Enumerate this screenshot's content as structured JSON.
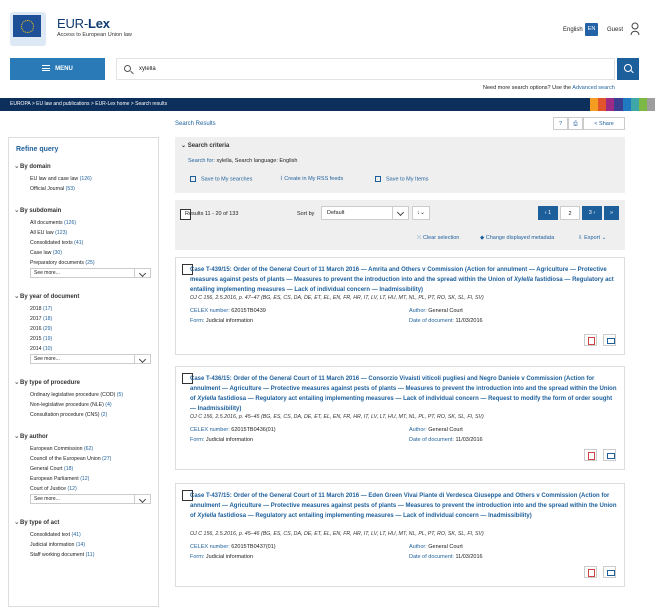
{
  "header": {
    "site_name_prefix": "EUR-",
    "site_name_bold": "Lex",
    "tagline": "Access to European Union law",
    "language": "English",
    "language_code": "EN",
    "user": "Guest"
  },
  "search": {
    "menu_label": "MENU",
    "query": "xylella",
    "advanced_prompt": "Need more search options? Use the",
    "advanced_link": "Advanced search"
  },
  "breadcrumb": "EUROPA  >  EU law and publications  >  EUR-Lex home  >  Search results",
  "colors": {
    "accent": "#1d5f9b",
    "menu": "#2a7ab8",
    "breadcrumb_bg": "#0d2f5b",
    "stripes": [
      "#f59d22",
      "#e2542b",
      "#9c2b86",
      "#3a3f91",
      "#1f7ac1",
      "#3fa7a7",
      "#7bb844",
      "#9e9e9e"
    ]
  },
  "sidebar": {
    "title": "Refine query",
    "groups": [
      {
        "heading": "By domain",
        "items": [
          {
            "label": "EU law and case law",
            "count": "(126)"
          },
          {
            "label": "Official Journal",
            "count": "(53)"
          }
        ],
        "see_more": ""
      },
      {
        "heading": "By subdomain",
        "items": [
          {
            "label": "All documents",
            "count": "(126)"
          },
          {
            "label": "All EU law",
            "count": "(123)"
          },
          {
            "label": "Consolidated texts",
            "count": "(41)"
          },
          {
            "label": "Case law",
            "count": "(30)"
          },
          {
            "label": "Preparatory documents",
            "count": "(25)"
          }
        ],
        "see_more": "See more..."
      },
      {
        "heading": "By year of document",
        "items": [
          {
            "label": "2018",
            "count": "(17)"
          },
          {
            "label": "2017",
            "count": "(18)"
          },
          {
            "label": "2016",
            "count": "(29)"
          },
          {
            "label": "2015",
            "count": "(19)"
          },
          {
            "label": "2014",
            "count": "(10)"
          }
        ],
        "see_more": "See more..."
      },
      {
        "heading": "By type of procedure",
        "items": [
          {
            "label": "Ordinary legislative procedure (COD)",
            "count": "(5)"
          },
          {
            "label": "Non-legislative procedure (NLE)",
            "count": "(4)"
          },
          {
            "label": "Consultation procedure (CNS)",
            "count": "(2)"
          }
        ],
        "see_more": ""
      },
      {
        "heading": "By author",
        "items": [
          {
            "label": "European Commission",
            "count": "(62)"
          },
          {
            "label": "Council of the European Union",
            "count": "(27)"
          },
          {
            "label": "General Court",
            "count": "(18)"
          },
          {
            "label": "European Parliament",
            "count": "(12)"
          },
          {
            "label": "Court of Justice",
            "count": "(12)"
          }
        ],
        "see_more": "See more..."
      },
      {
        "heading": "By type of act",
        "items": [
          {
            "label": "Consolidated text",
            "count": "(41)"
          },
          {
            "label": "Judicial information",
            "count": "(14)"
          },
          {
            "label": "Staff working document",
            "count": "(11)"
          }
        ],
        "see_more": ""
      }
    ]
  },
  "main": {
    "title": "Search Results",
    "help": "?",
    "print": "⎙",
    "share": "Share",
    "criteria_heading": "Search criteria",
    "criteria_label": "Search for:",
    "criteria_value": "xylella, Search language: English",
    "save_searches": "Save to My searches",
    "create_rss": "Create in My RSS feeds",
    "save_items": "Save to My Items",
    "results_count": "Results 11 - 20 of 133",
    "sort_label": "Sort by",
    "sort_value": "Default",
    "page_current": "2",
    "clear_selection": "Clear selection",
    "change_metadata": "Change displayed metadata",
    "export": "Export"
  },
  "documents": [
    {
      "title_before": "Case T-439/15: Order of the General Court of 11 March 2016 — Amrita and Others v Commission (Action for annulment — Agriculture — Protective measures against pests of plants — Measures to prevent the introduction into and the spread within the Union of ",
      "title_italic": "Xylella",
      "title_after": " fastidiosa — Regulatory act entailing implementing measures — Lack of individual concern — Inadmissibility)",
      "oj": "OJ C 156, 2.5.2016, p. 47–47 (BG, ES, CS, DA, DE, ET, EL, EN, FR, HR, IT, LV, LT, HU, MT, NL, PL, PT, RO, SK, SL, FI, SV)",
      "celex_label": "CELEX number:",
      "celex": "62015TB0439",
      "form_label": "Form:",
      "form": "Judicial information",
      "author_label": "Author:",
      "author": "General Court",
      "date_label": "Date of document:",
      "date": "11/03/2016"
    },
    {
      "title_before": "Case T-436/15: Order of the General Court of 11 March 2016 — Consorzio Vivaisti viticoli pugliesi and Negro Daniele v Commission (Action for annulment — Agriculture — Protective measures against pests of plants — Measures to prevent the introduction into and the spread within the Union of ",
      "title_italic": "Xylella",
      "title_after": " fastidiosa — Regulatory act entailing implementing measures — Lack of individual concern — Request to modify the form of order sought — Inadmissibility)",
      "oj": "OJ C 156, 2.5.2016, p. 45–45 (BG, ES, CS, DA, DE, ET, EL, EN, FR, HR, IT, LV, LT, HU, MT, NL, PL, PT, RO, SK, SL, FI, SV)",
      "celex_label": "CELEX number:",
      "celex": "62015TB0436(01)",
      "form_label": "Form:",
      "form": "Judicial information",
      "author_label": "Author:",
      "author": "General Court",
      "date_label": "Date of document:",
      "date": "11/03/2016"
    },
    {
      "title_before": "Case T-437/15: Order of the General Court of 11 March 2016 — Eden Green Vivai Piante di Verdesca Giuseppe and Others v Commission (Action for annulment — Agriculture — Protective measures against pests of plants — Measures to prevent the introduction into and the spread within the Union of ",
      "title_italic": "Xylella",
      "title_after": " fastidiosa — Regulatory act entailing implementing measures — Lack of individual concern — Inadmissibility)",
      "oj": "OJ C 156, 2.5.2016, p. 45–46 (BG, ES, CS, DA, DE, ET, EL, EN, FR, HR, IT, LV, LT, HU, MT, NL, PL, PT, RO, SK, SL, FI, SV)",
      "celex_label": "CELEX number:",
      "celex": "62015TB0437(01)",
      "form_label": "Form:",
      "form": "Judicial information",
      "author_label": "Author:",
      "author": "General Court",
      "date_label": "Date of document:",
      "date": "11/03/2016"
    }
  ]
}
